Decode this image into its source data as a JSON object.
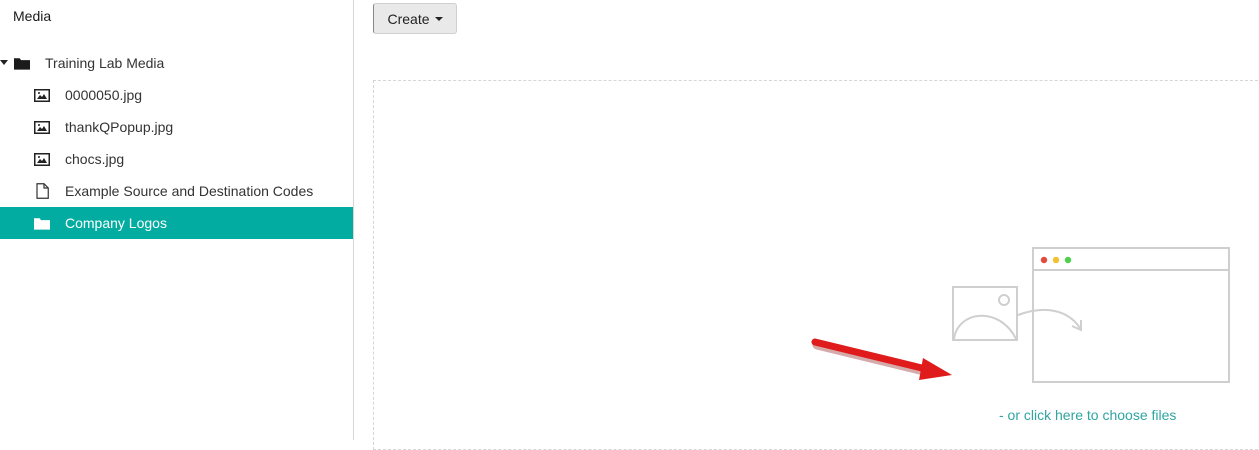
{
  "sidebar": {
    "title": "Media",
    "tree": [
      {
        "label": "Training Lab Media",
        "icon": "folder-icon",
        "expanded": true
      },
      {
        "label": "0000050.jpg",
        "icon": "image-icon"
      },
      {
        "label": "thankQPopup.jpg",
        "icon": "image-icon"
      },
      {
        "label": "chocs.jpg",
        "icon": "image-icon"
      },
      {
        "label": "Example Source and Destination Codes",
        "icon": "document-icon"
      },
      {
        "label": "Company Logos",
        "icon": "folder-icon",
        "selected": true
      }
    ]
  },
  "toolbar": {
    "create_label": "Create"
  },
  "dropzone": {
    "choose_text": "- or click here to choose files"
  },
  "colors": {
    "accent": "#03aca1",
    "link": "#2fa5a0",
    "arrow": "#e01b1b",
    "dot_red": "#e04b3c",
    "dot_yellow": "#f2c12e",
    "dot_green": "#4cd14c"
  }
}
